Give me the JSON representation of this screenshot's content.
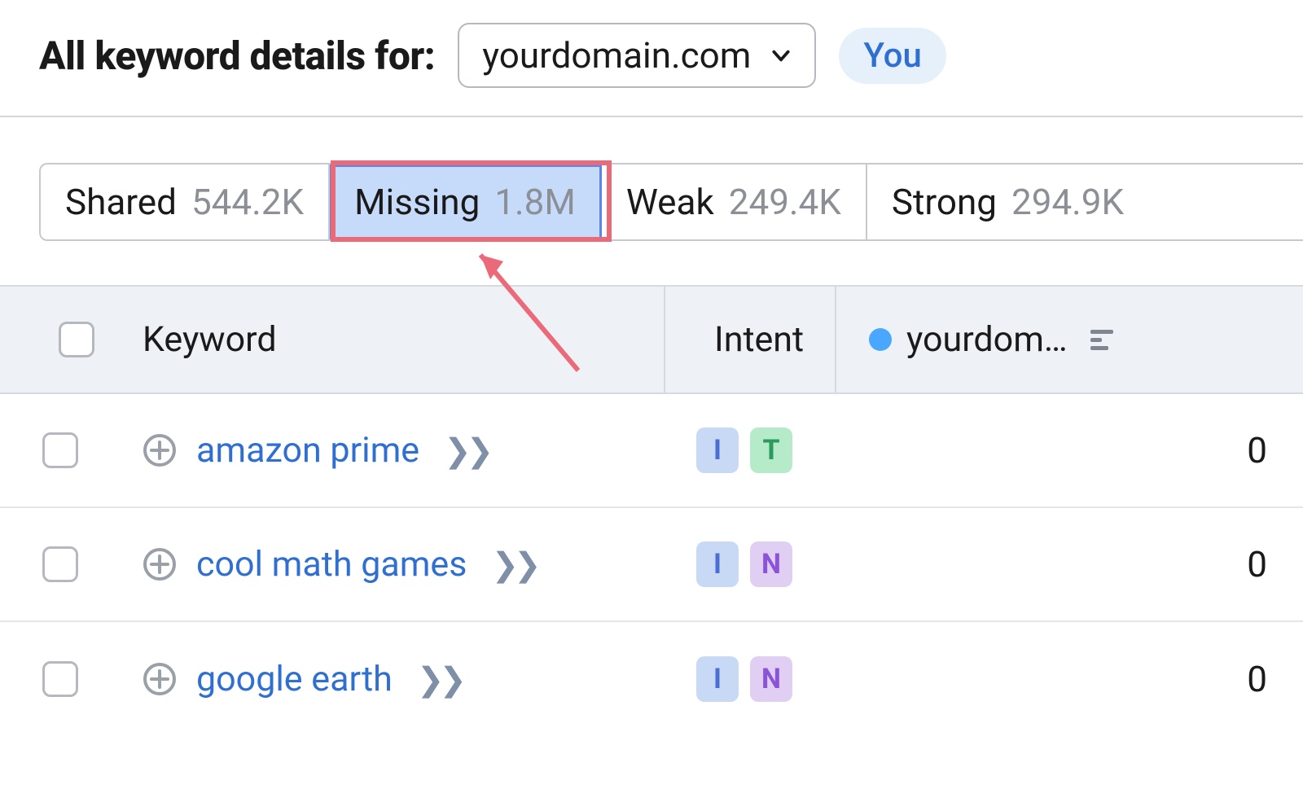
{
  "header": {
    "title": "All keyword details for:",
    "domain": "yourdomain.com",
    "you_label": "You"
  },
  "tabs": [
    {
      "label": "Shared",
      "count": "544.2K",
      "active": false
    },
    {
      "label": "Missing",
      "count": "1.8M",
      "active": true
    },
    {
      "label": "Weak",
      "count": "249.4K",
      "active": false
    },
    {
      "label": "Strong",
      "count": "294.9K",
      "active": false
    }
  ],
  "columns": {
    "keyword": "Keyword",
    "intent": "Intent",
    "domain": "yourdom…"
  },
  "rows": [
    {
      "keyword": "amazon prime",
      "intents": [
        "I",
        "T"
      ],
      "value": "0"
    },
    {
      "keyword": "cool math games",
      "intents": [
        "I",
        "N"
      ],
      "value": "0"
    },
    {
      "keyword": "google earth",
      "intents": [
        "I",
        "N"
      ],
      "value": "0"
    }
  ],
  "colors": {
    "accent_blue": "#2f6fd1",
    "highlight_red": "#ea6a7a"
  }
}
